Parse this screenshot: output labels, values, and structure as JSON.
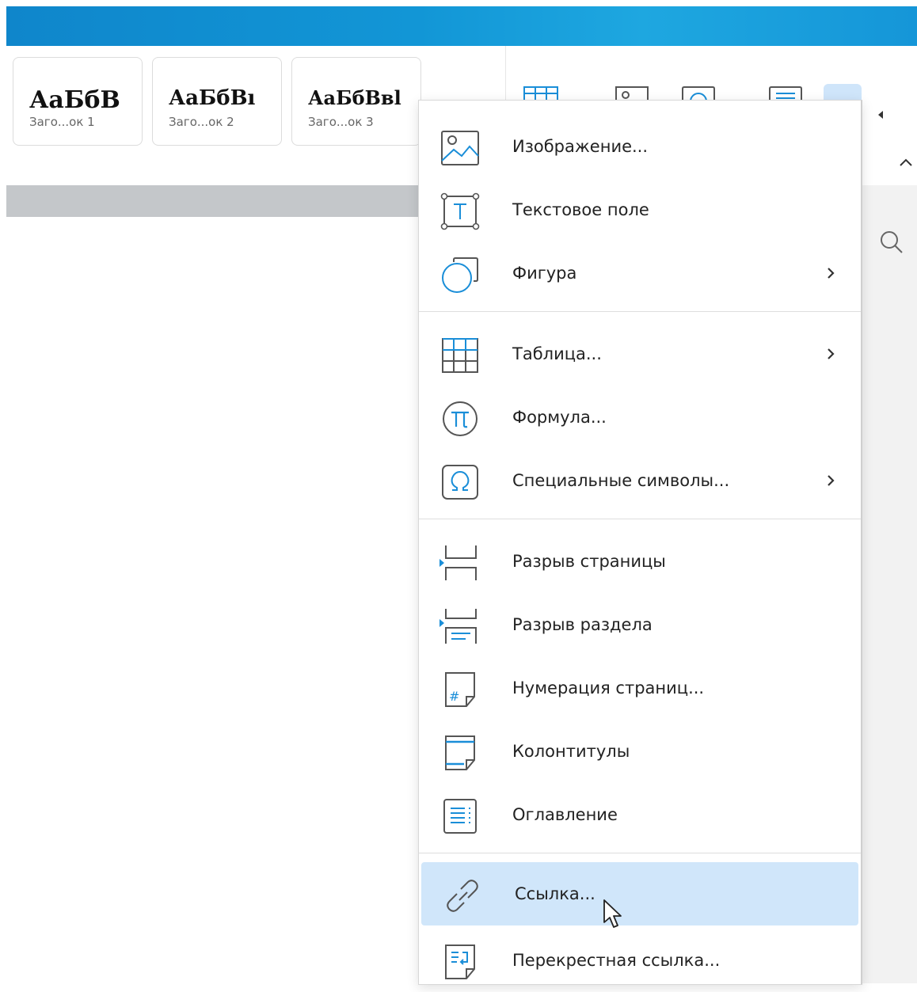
{
  "ribbon": {
    "styles": [
      {
        "sample": "АаБбВ",
        "caption": "Заго...ок 1"
      },
      {
        "sample": "АаБбВı",
        "caption": "Заго...ок 2"
      },
      {
        "sample": "АаБбВвl",
        "caption": "Заго...ок 3"
      }
    ]
  },
  "menu": {
    "items": [
      {
        "label": "Изображение...",
        "icon": "image-icon",
        "submenu": false
      },
      {
        "label": "Текстовое поле",
        "icon": "text-box-icon",
        "submenu": false
      },
      {
        "label": "Фигура",
        "icon": "shape-icon",
        "submenu": true
      },
      {
        "label": "Таблица...",
        "icon": "table-icon",
        "submenu": true
      },
      {
        "label": "Формула...",
        "icon": "formula-icon",
        "submenu": false
      },
      {
        "label": "Специальные символы...",
        "icon": "omega-icon",
        "submenu": true
      },
      {
        "label": "Разрыв страницы",
        "icon": "page-break-icon",
        "submenu": false
      },
      {
        "label": "Разрыв раздела",
        "icon": "section-break-icon",
        "submenu": false
      },
      {
        "label": "Нумерация страниц...",
        "icon": "page-number-icon",
        "submenu": false
      },
      {
        "label": "Колонтитулы",
        "icon": "header-footer-icon",
        "submenu": false
      },
      {
        "label": "Оглавление",
        "icon": "toc-icon",
        "submenu": false
      },
      {
        "label": "Ссылка...",
        "icon": "link-icon",
        "submenu": false,
        "highlighted": true
      },
      {
        "label": "Перекрестная ссылка...",
        "icon": "cross-reference-icon",
        "submenu": false
      }
    ]
  },
  "colors": {
    "accent": "#1a8ed8",
    "highlight": "#d0e6fa",
    "titlebar": "#1296d6"
  }
}
